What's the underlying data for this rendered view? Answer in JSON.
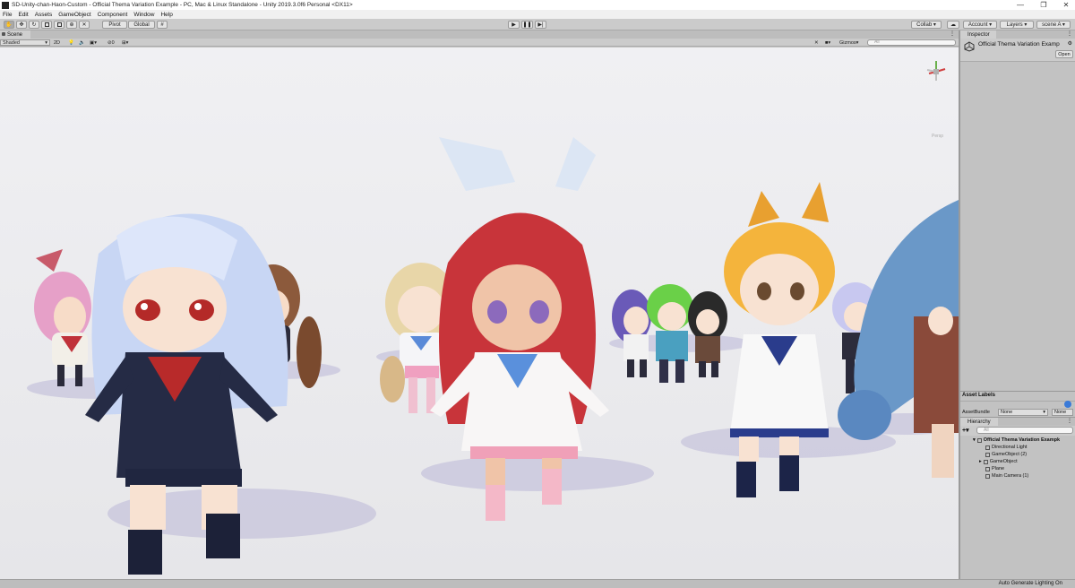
{
  "window": {
    "title": "SD-Unity-chan-Haon-Custom - Official Thema Variation Example - PC, Mac & Linux Standalone - Unity 2019.3.0f6 Personal <DX11>",
    "controls": [
      "—",
      "❐",
      "✕"
    ]
  },
  "menu": [
    "File",
    "Edit",
    "Assets",
    "GameObject",
    "Component",
    "Window",
    "Help"
  ],
  "toolbar": {
    "pivot_label": "Pivot",
    "global_label": "Global",
    "collab_label": "Collab ▾",
    "account_label": "Account ▾",
    "layers_label": "Layers ▾",
    "layout_label": "scene A ▾"
  },
  "scene": {
    "tab_label": "Scene",
    "draw_mode": "Shaded",
    "mode_2d": "2D",
    "gizmos_label": "Gizmos",
    "search_placeholder": "All",
    "hidden_count": "0",
    "persp_label": "Persp"
  },
  "inspector": {
    "tab_label": "Inspector",
    "object_title": "Official Thema Variation Examp",
    "open_button": "Open"
  },
  "asset_labels": {
    "title": "Asset Labels",
    "bundle_label": "AssetBundle",
    "bundle_value": "None",
    "variant_value": "None"
  },
  "hierarchy": {
    "tab_label": "Hierarchy",
    "search_placeholder": "All",
    "root": "Official Thema Variation Exampk",
    "items": [
      "Directional Light",
      "GameObject (2)",
      "GameObject",
      "Plane",
      "Main Camera (1)"
    ]
  },
  "status": {
    "text": "Auto Generate Lighting On"
  },
  "colors": {
    "unity_toolbar": "#cbcbcb",
    "panel_bg": "#c2c2c2",
    "viewport_bg": "#ececee"
  }
}
